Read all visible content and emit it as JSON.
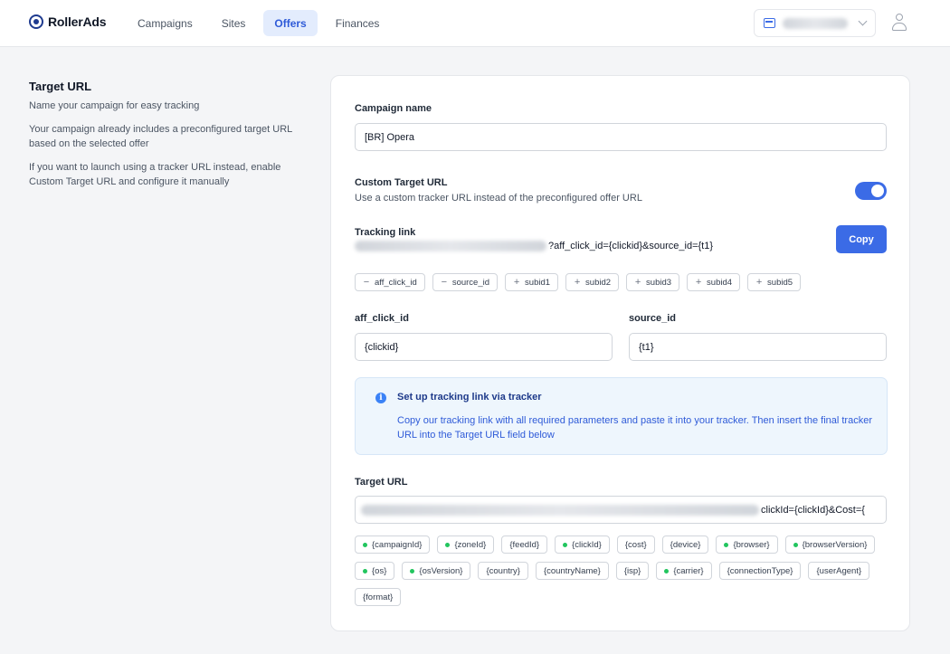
{
  "header": {
    "logo_text": "RollerAds",
    "nav": [
      {
        "label": "Campaigns"
      },
      {
        "label": "Sites"
      },
      {
        "label": "Offers"
      },
      {
        "label": "Finances"
      }
    ]
  },
  "sidebar": {
    "title": "Target URL",
    "paragraphs": [
      "Name your campaign for easy tracking",
      "Your campaign already includes a preconfigured target URL based on the selected offer",
      "If you want to launch using a tracker URL instead, enable Custom Target URL and configure it manually"
    ]
  },
  "form": {
    "campaign_name_label": "Campaign name",
    "campaign_name_value": "[BR] Opera",
    "custom_url_label": "Custom Target URL",
    "custom_url_desc": "Use a custom tracker URL instead of the preconfigured offer URL",
    "custom_url_enabled": true,
    "tracking_link_label": "Tracking link",
    "tracking_link_visible": "?aff_click_id={clickid}&source_id={t1}",
    "copy_label": "Copy",
    "param_chips": [
      {
        "sign": "−",
        "label": "aff_click_id"
      },
      {
        "sign": "−",
        "label": "source_id"
      },
      {
        "sign": "+",
        "label": "subid1"
      },
      {
        "sign": "+",
        "label": "subid2"
      },
      {
        "sign": "+",
        "label": "subid3"
      },
      {
        "sign": "+",
        "label": "subid4"
      },
      {
        "sign": "+",
        "label": "subid5"
      }
    ],
    "aff_click_id_label": "aff_click_id",
    "aff_click_id_value": "{clickid}",
    "source_id_label": "source_id",
    "source_id_value": "{t1}",
    "info_title": "Set up tracking link via tracker",
    "info_text": "Copy our tracking link with all required parameters and paste it into your tracker. Then insert the final tracker URL into the Target URL field below",
    "target_url_label": "Target URL",
    "target_url_visible": "clickId={clickId}&Cost={",
    "target_tokens": [
      {
        "label": "{campaignId}",
        "active": true
      },
      {
        "label": "{zoneId}",
        "active": true
      },
      {
        "label": "{feedId}",
        "active": false
      },
      {
        "label": "{clickId}",
        "active": true
      },
      {
        "label": "{cost}",
        "active": false
      },
      {
        "label": "{device}",
        "active": false
      },
      {
        "label": "{browser}",
        "active": true
      },
      {
        "label": "{browserVersion}",
        "active": true
      },
      {
        "label": "{os}",
        "active": true
      },
      {
        "label": "{osVersion}",
        "active": true
      },
      {
        "label": "{country}",
        "active": false
      },
      {
        "label": "{countryName}",
        "active": false
      },
      {
        "label": "{isp}",
        "active": false
      },
      {
        "label": "{carrier}",
        "active": true
      },
      {
        "label": "{connectionType}",
        "active": false
      },
      {
        "label": "{userAgent}",
        "active": false
      },
      {
        "label": "{format}",
        "active": false
      }
    ]
  },
  "colors": {
    "accent": "#3b6be6",
    "token_dot": "#22c55e",
    "info_bg": "#eef6fd"
  }
}
